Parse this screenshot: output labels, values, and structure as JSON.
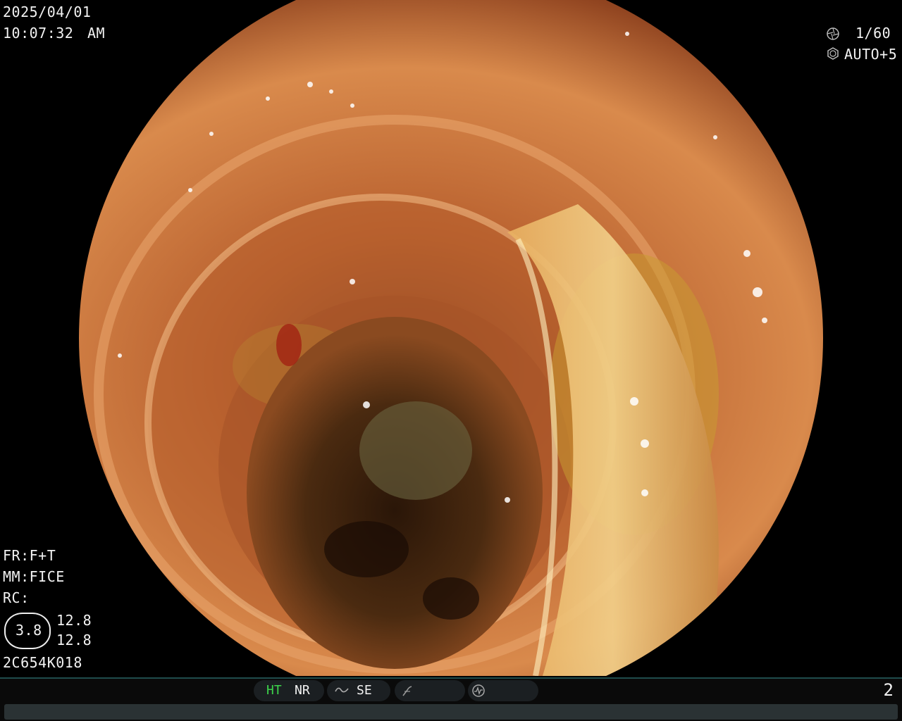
{
  "osd": {
    "date": "2025/04/01",
    "time": "10:07:32",
    "ampm": "AM",
    "shutter": "1/60",
    "iris": "AUTO+5",
    "fr": "FR:F+T",
    "mm": "MM:FICE",
    "rc": "RC:",
    "scale_value": "3.8",
    "scale_a": "12.8",
    "scale_b": "12.8",
    "scope_id": "2C654K018"
  },
  "bottom_bar": {
    "ht": "HT",
    "nr": "NR",
    "se": "SE",
    "image_count": "2"
  },
  "colors": {
    "ht_active": "#3cd34a",
    "mucosa_base": "#c0703a",
    "bile": "#c8a030"
  }
}
